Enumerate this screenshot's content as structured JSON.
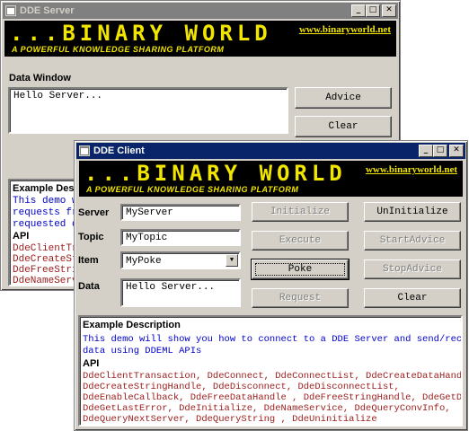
{
  "server_window": {
    "title": "DDE Server",
    "banner": {
      "logo": "...BINARY WORLD",
      "tagline": "A POWERFUL KNOWLEDGE SHARING PLATFORM",
      "url": "www.binaryworld.net"
    },
    "data_window_label": "Data Window",
    "data_text": "Hello Server...",
    "advice_label": "Advice",
    "clear_label": "Clear",
    "example_title": "Example Desc",
    "example_lines": "This demo w\nrequests fr\nrequested d",
    "api_label": "API",
    "api_lines": "DdeClientTr\nDdeCreateSt\nDdeFreeStri\nDdeNameServ"
  },
  "client_window": {
    "title": "DDE Client",
    "banner": {
      "logo": "...BINARY WORLD",
      "tagline": "A POWERFUL KNOWLEDGE SHARING PLATFORM",
      "url": "www.binaryworld.net"
    },
    "server_label": "Server",
    "server_value": "MyServer",
    "topic_label": "Topic",
    "topic_value": "MyTopic",
    "item_label": "Item",
    "item_value": "MyPoke",
    "data_label": "Data",
    "data_value": "Hello Server...",
    "buttons": {
      "initialize": "Initialize",
      "uninitialize": "UnInitialize",
      "execute": "Execute",
      "start_advice": "StartAdvice",
      "poke": "Poke",
      "stop_advice": "StopAdvice",
      "request": "Request",
      "clear": "Clear"
    },
    "example_title": "Example Description",
    "example_text": "This demo will show you how to connect to a DDE Server and send/receive\ndata using DDEML APIs",
    "api_label": "API",
    "api_text": "DdeClientTransaction, DdeConnect, DdeConnectList, DdeCreateDataHandle ,\nDdeCreateStringHandle, DdeDisconnect, DdeDisconnectList,\nDdeEnableCallback, DdeFreeDataHandle , DdeFreeStringHandle, DdeGetData,\nDdeGetLastError, DdeInitialize, DdeNameService, DdeQueryConvInfo,\nDdeQueryNextServer, DdeQueryString , DdeUninitialize"
  }
}
